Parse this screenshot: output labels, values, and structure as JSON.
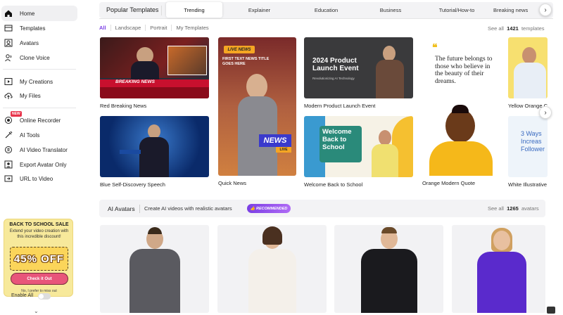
{
  "sidebar": {
    "items": [
      {
        "label": "Home",
        "icon": "home-icon"
      },
      {
        "label": "Templates",
        "icon": "templates-icon"
      },
      {
        "label": "Avatars",
        "icon": "avatar-icon"
      },
      {
        "label": "Clone Voice",
        "icon": "voice-icon"
      },
      {
        "label": "My Creations",
        "icon": "play-icon"
      },
      {
        "label": "My Files",
        "icon": "cloud-upload-icon"
      },
      {
        "label": "Online Recorder",
        "icon": "record-icon",
        "badge": "NEW"
      },
      {
        "label": "AI Tools",
        "icon": "tools-icon"
      },
      {
        "label": "AI Video Translator",
        "icon": "translate-icon"
      },
      {
        "label": "Export Avatar Only",
        "icon": "export-icon"
      },
      {
        "label": "URL to Video",
        "icon": "link-icon"
      }
    ]
  },
  "promo": {
    "title": "BACK TO SCHOOL SALE",
    "subtitle": "Extend your video creation with this incredible discount!",
    "discount": "45% OFF",
    "button": "Check it Out",
    "skip": "No, I prefer to miss out",
    "enable_all": "Enable All"
  },
  "templates": {
    "heading": "Popular Templates",
    "tabs": [
      "Trending",
      "Explainer",
      "Education",
      "Business",
      "Tutorial/How-to",
      "Breaking news"
    ],
    "active_tab": "Trending",
    "filters": [
      "All",
      "Landscape",
      "Portrait",
      "My Templates"
    ],
    "see_all_prefix": "See all",
    "count": "1421",
    "see_all_suffix": "templates",
    "cards": [
      {
        "title": "Red Breaking News",
        "overlay": "BREAKING NEWS"
      },
      {
        "title": "Blue Self-Discovery Speech"
      },
      {
        "title": "Quick News",
        "overlay_top": "LIVE NEWS",
        "overlay_sub": "FIRST TEXT NEWS TITLE GOES HERE",
        "overlay_bottom": "NEWS",
        "overlay_live": "LIVE"
      },
      {
        "title": "Modern Product Launch Event",
        "overlay": "2024 Product Launch Event",
        "overlay_sub": "Revolutionizing AI Technology"
      },
      {
        "title": "Welcome Back to School",
        "overlay": "Welcome Back to School"
      },
      {
        "title": "Orange Modern Quote",
        "quote": "The future belongs to those who believe in the beauty of their dreams."
      },
      {
        "title": "Yellow Orange C"
      },
      {
        "title": "White Illustrative",
        "overlay": "3 Ways Increas Follower"
      }
    ]
  },
  "avatars": {
    "title": "AI Avatars",
    "subtitle": "Create AI videos with realistic avatars",
    "badge": "RECOMMENDED",
    "see_all_prefix": "See all",
    "count": "1265",
    "see_all_suffix": "avatars"
  },
  "colors": {
    "accent": "#7b3fe4",
    "breaking_red": "#c8102e",
    "news_orange": "#f5a623",
    "quote_yellow": "#f7e27a"
  }
}
